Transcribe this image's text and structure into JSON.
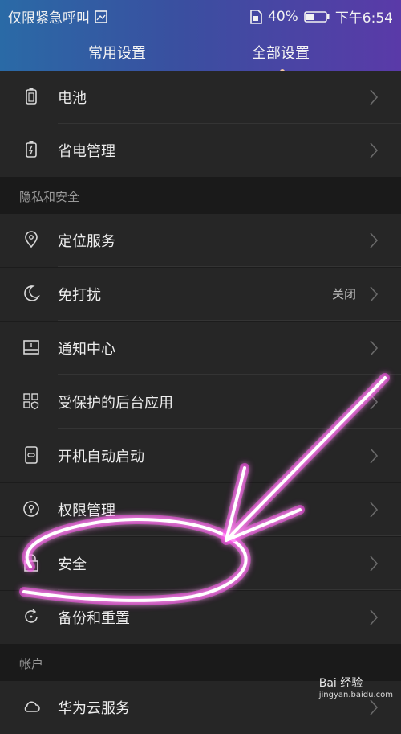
{
  "status_bar": {
    "carrier": "仅限紧急呼叫",
    "battery": "40%",
    "time": "下午6:54"
  },
  "tabs": [
    {
      "label": "常用设置",
      "active": false
    },
    {
      "label": "全部设置",
      "active": true
    }
  ],
  "items": {
    "battery": {
      "label": "电池",
      "icon": "battery-icon"
    },
    "power_saving": {
      "label": "省电管理",
      "icon": "power-saving-icon"
    },
    "privacy_section": "隐私和安全",
    "location": {
      "label": "定位服务",
      "icon": "location-pin-icon"
    },
    "dnd": {
      "label": "免打扰",
      "value": "关闭",
      "icon": "moon-icon"
    },
    "notifications": {
      "label": "通知中心",
      "icon": "notification-center-icon"
    },
    "protected_apps": {
      "label": "受保护的后台应用",
      "icon": "protected-apps-icon"
    },
    "autostart": {
      "label": "开机自动启动",
      "icon": "autostart-icon"
    },
    "permissions": {
      "label": "权限管理",
      "icon": "key-shield-icon"
    },
    "security": {
      "label": "安全",
      "icon": "lock-icon"
    },
    "backup": {
      "label": "备份和重置",
      "icon": "reset-icon"
    },
    "account_section": "帐户",
    "huawei_cloud": {
      "label": "华为云服务",
      "icon": "cloud-icon"
    }
  },
  "watermark": {
    "brand": "Bai 经验",
    "url": "jingyan.baidu.com"
  },
  "colors": {
    "annotation": "#ff3cf0",
    "header_start": "#2a6aa6",
    "header_end": "#5a3aa8"
  }
}
